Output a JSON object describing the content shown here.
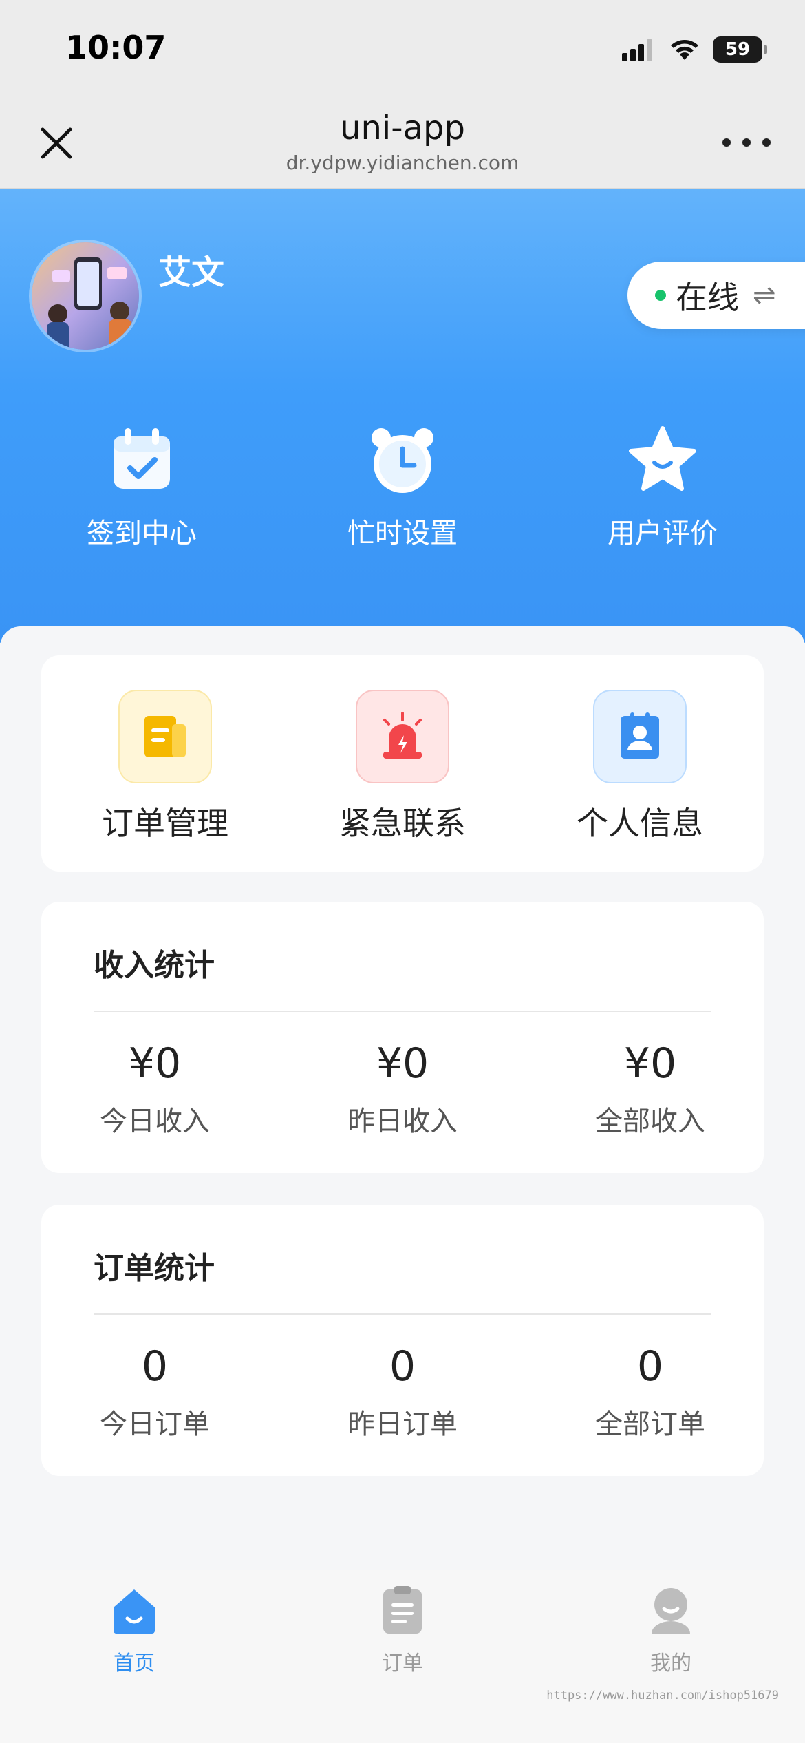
{
  "status_bar": {
    "time": "10:07",
    "battery": "59"
  },
  "nav": {
    "title": "uni-app",
    "subtitle": "dr.ydpw.yidianchen.com"
  },
  "profile": {
    "name": "艾文",
    "status": "在线",
    "switch_symbol": "⇌"
  },
  "quick_actions": [
    {
      "label": "签到中心",
      "icon": "calendar-check-icon"
    },
    {
      "label": "忙时设置",
      "icon": "alarm-clock-icon"
    },
    {
      "label": "用户评价",
      "icon": "star-icon"
    }
  ],
  "menu": [
    {
      "label": "订单管理",
      "icon": "order-document-icon",
      "color": "#f5b800"
    },
    {
      "label": "紧急联系",
      "icon": "alarm-siren-icon",
      "color": "#f2464b"
    },
    {
      "label": "个人信息",
      "icon": "profile-card-icon",
      "color": "#3a8ff0"
    }
  ],
  "income": {
    "title": "收入统计",
    "items": [
      {
        "value": "¥0",
        "label": "今日收入"
      },
      {
        "value": "¥0",
        "label": "昨日收入"
      },
      {
        "value": "¥0",
        "label": "全部收入"
      }
    ]
  },
  "orders": {
    "title": "订单统计",
    "items": [
      {
        "value": "0",
        "label": "今日订单"
      },
      {
        "value": "0",
        "label": "昨日订单"
      },
      {
        "value": "0",
        "label": "全部订单"
      }
    ]
  },
  "tabs": [
    {
      "label": "首页",
      "icon": "home-icon",
      "active": true
    },
    {
      "label": "订单",
      "icon": "clipboard-icon",
      "active": false
    },
    {
      "label": "我的",
      "icon": "user-icon",
      "active": false
    }
  ],
  "watermark": "https://www.huzhan.com/ishop51679",
  "colors": {
    "primary": "#3a94f5",
    "online": "#17c36b",
    "active_tab": "#2e8ef0"
  }
}
